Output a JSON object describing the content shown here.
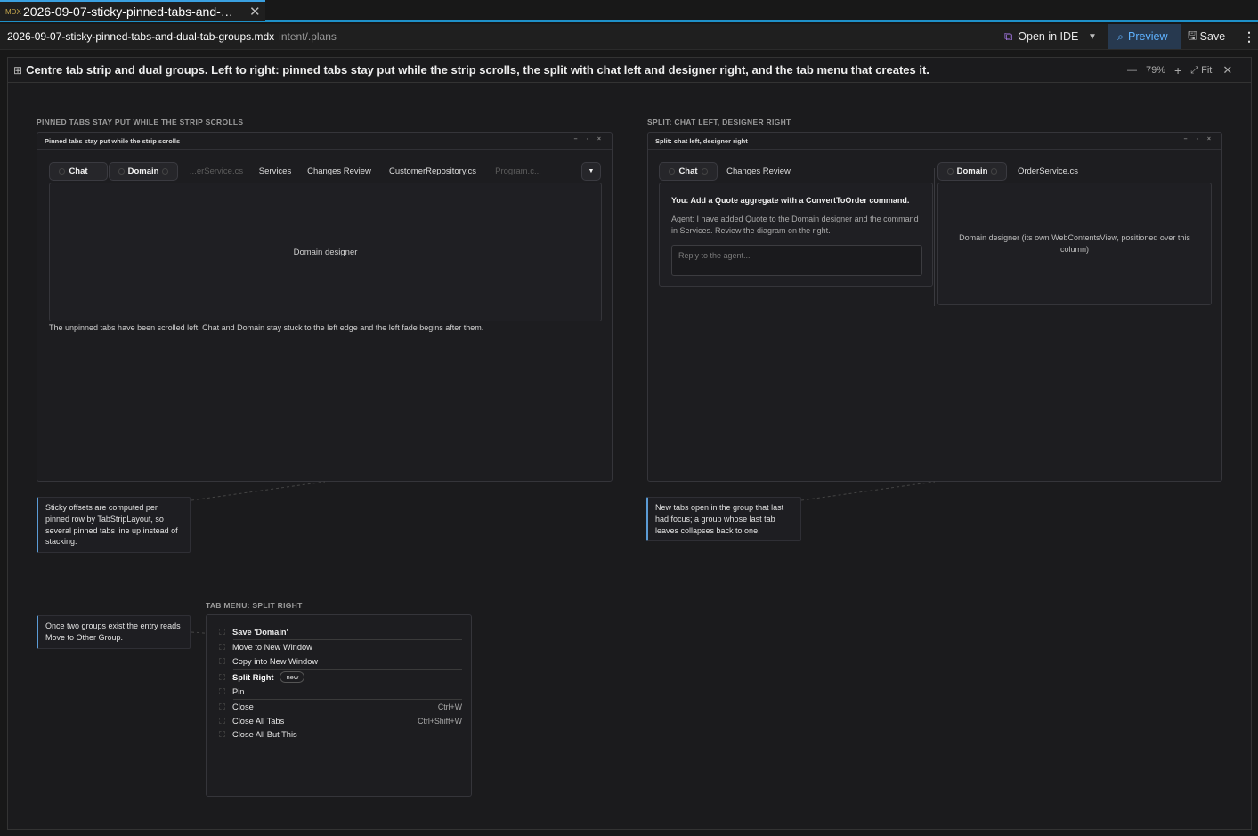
{
  "tab": {
    "icon_text": "MDX",
    "title": "2026-09-07-sticky-pinned-tabs-and-d…",
    "close": "✕"
  },
  "topbar": {
    "filename": "2026-09-07-sticky-pinned-tabs-and-dual-tab-groups.mdx",
    "path": "intent/.plans",
    "open_ide": "Open in IDE",
    "preview": "Preview",
    "save": "Save"
  },
  "header": {
    "title": "Centre tab strip and dual groups. Left to right: pinned tabs stay put while the strip scrolls, the split with chat left and designer right, and the tab menu that creates it.",
    "zoom": "79%",
    "fit": "Fit"
  },
  "panel1": {
    "section_label": "PINNED TABS STAY PUT WHILE THE STRIP SCROLLS",
    "window_title": "Pinned tabs stay put while the strip scrolls",
    "tabs": [
      "Chat",
      "Domain",
      "...erService.cs",
      "Services",
      "Changes Review",
      "CustomerRepository.cs",
      "Program.c..."
    ],
    "content": "Domain designer",
    "caption": "The unpinned tabs have been scrolled left; Chat and Domain stay stuck to the left edge and the left fade begins after them."
  },
  "panel2": {
    "section_label": "SPLIT: CHAT LEFT, DESIGNER RIGHT",
    "window_title": "Split: chat left, designer right",
    "left_tabs": [
      "Chat",
      "Changes Review"
    ],
    "right_tabs": [
      "Domain",
      "OrderService.cs"
    ],
    "you_label": "You:",
    "you_text": "Add a Quote aggregate with a ConvertToOrder command.",
    "agent_text": "Agent: I have added Quote to the Domain designer and the command in Services. Review the diagram on the right.",
    "reply_placeholder": "Reply to the agent...",
    "right_content": "Domain designer (its own WebContentsView, positioned over this column)"
  },
  "notes": {
    "note1": "Sticky offsets are computed per pinned row by TabStripLayout, so several pinned tabs line up instead of stacking.",
    "note2": "New tabs open in the group that last had focus; a group whose last tab leaves collapses back to one.",
    "note3": "Once two groups exist the entry reads Move to Other Group."
  },
  "menu": {
    "section_label": "TAB MENU: SPLIT RIGHT",
    "items": [
      {
        "label": "Save 'Domain'",
        "shortcut": ""
      },
      {
        "label": "Move to New Window",
        "shortcut": ""
      },
      {
        "label": "Copy into New Window",
        "shortcut": ""
      },
      {
        "label": "Split Right",
        "shortcut": "",
        "badge": "new"
      },
      {
        "label": "Pin",
        "shortcut": ""
      },
      {
        "label": "Close",
        "shortcut": "Ctrl+W"
      },
      {
        "label": "Close All Tabs",
        "shortcut": "Ctrl+Shift+W"
      },
      {
        "label": "Close All But This",
        "shortcut": ""
      }
    ]
  },
  "colors": {
    "accent": "#1e90c8",
    "preview": "#5fb2ff",
    "note_border": "#5b9bd5",
    "ide_icon": "#a77ae8"
  },
  "icons": {
    "mdx": "mdx-file-icon",
    "ide": "visual-studio-icon",
    "preview": "preview-icon",
    "save": "save-icon",
    "more": "kebab-icon",
    "layout": "grid-icon"
  }
}
